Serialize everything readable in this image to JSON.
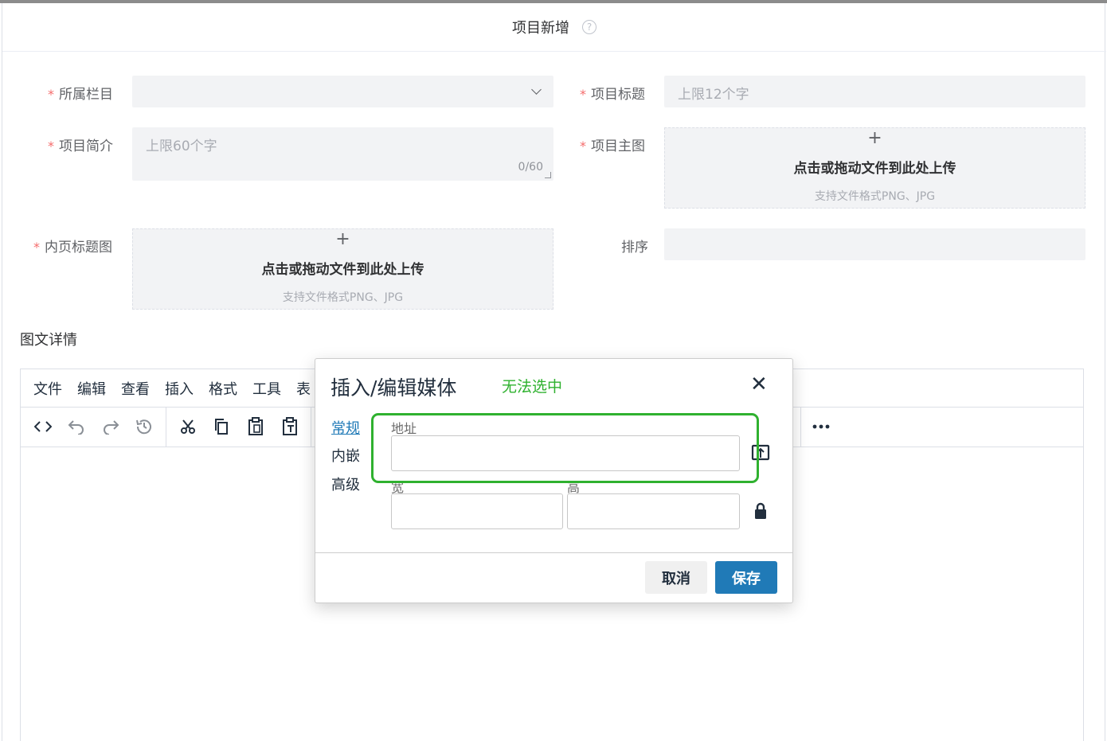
{
  "header": {
    "title": "项目新增"
  },
  "form": {
    "category": {
      "label": "所属栏目",
      "value": ""
    },
    "title": {
      "label": "项目标题",
      "placeholder": "上限12个字"
    },
    "intro": {
      "label": "项目简介",
      "placeholder": "上限60个字",
      "counter": "0/60"
    },
    "main_image": {
      "label": "项目主图",
      "plus": "+",
      "text": "点击或拖动文件到此处上传",
      "hint": "支持文件格式PNG、JPG"
    },
    "inner_image": {
      "label": "内页标题图",
      "plus": "+",
      "text": "点击或拖动文件到此处上传",
      "hint": "支持文件格式PNG、JPG"
    },
    "sort": {
      "label": "排序",
      "value": ""
    },
    "required_mark": "*"
  },
  "editor": {
    "section_title": "图文详情",
    "menu": [
      "文件",
      "编辑",
      "查看",
      "插入",
      "格式",
      "工具",
      "表"
    ],
    "toolbar": [
      "source-code-icon",
      "undo-icon",
      "redo-icon",
      "history-icon",
      "cut-icon",
      "copy-icon",
      "paste-icon",
      "paste-text-icon",
      "more-icon"
    ]
  },
  "dialog": {
    "title": "插入/编辑媒体",
    "annotation": "无法选中",
    "tabs": [
      "常规",
      "内嵌",
      "高级"
    ],
    "active_tab": "常规",
    "url_label": "地址",
    "width_label": "宽",
    "height_label": "高",
    "cancel": "取消",
    "save": "保存"
  },
  "colors": {
    "primary": "#207ab7",
    "annotation_green": "#2fb12f",
    "required_red": "#f56c6c",
    "input_bg": "#f2f3f5"
  }
}
